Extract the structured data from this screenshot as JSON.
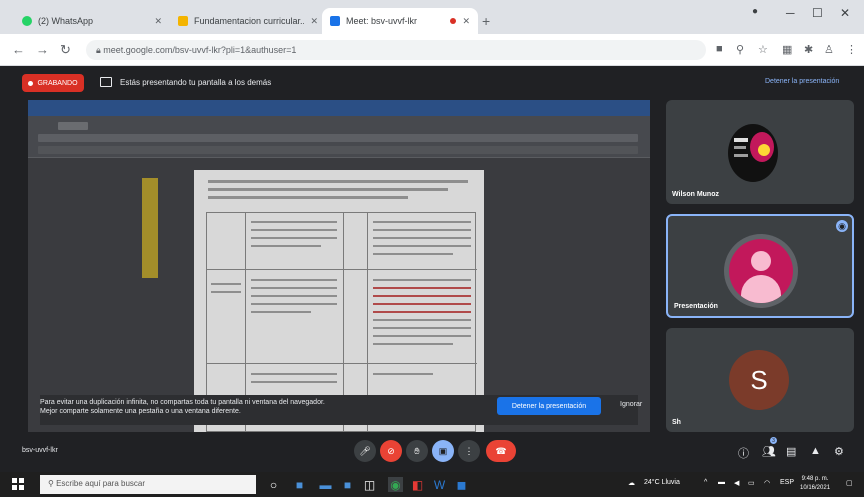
{
  "browser": {
    "tabs": [
      {
        "label": "(2) WhatsApp",
        "color": "#25d366",
        "active": false
      },
      {
        "label": "Fundamentacion curricular...",
        "color": "#f4b400",
        "active": false
      },
      {
        "label": "Meet: bsv-uvvf-lkr",
        "color": "#1a73e8",
        "active": true
      }
    ],
    "url": "meet.google.com/bsv-uvvf-lkr?pli=1&authuser=1",
    "new_tab_label": "+",
    "minimize": "─",
    "maximize": "☐",
    "close": "✕"
  },
  "meet": {
    "record_label": "GRABANDO",
    "presenting_text": "Estás presentando tu pantalla a los demás",
    "stop_presenting": "Detener la presentación",
    "notification": {
      "text": "Para evitar una duplicación infinita, no compartas toda tu pantalla ni ventana del navegador. Mejor comparte solamente una pestaña o una ventana diferente.",
      "stop_button": "Detener la presentación",
      "ignore_button": "Ignorar"
    },
    "participants": [
      {
        "name": "Wilson Munoz",
        "type": "photo"
      },
      {
        "name": "Presentación",
        "type": "avatar"
      },
      {
        "name": "Sh",
        "type": "letter",
        "initial": "S"
      }
    ],
    "meeting_code": "bsv-uvvf-lkr",
    "controls": [
      "mic-icon",
      "camera-off-icon",
      "hand-icon",
      "present-icon",
      "more-icon",
      "hangup-icon"
    ],
    "chat_badge": "3"
  },
  "taskbar": {
    "search_placeholder": "Escribe aquí para buscar",
    "weather": "24°C Lluvia",
    "language": "ESP",
    "time": "9:48 p. m.",
    "date": "10/16/2021"
  },
  "colors": {
    "meet_bg": "#202124",
    "record_red": "#d93025",
    "present_blue": "#1a73e8",
    "tile_bg": "#3c4043"
  }
}
